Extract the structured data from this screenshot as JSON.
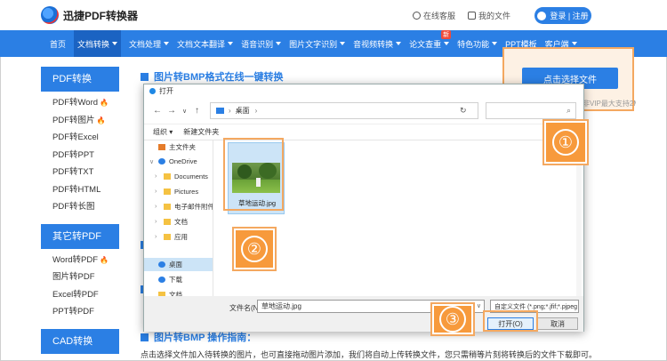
{
  "header": {
    "logo_text": "迅捷PDF转换器",
    "links": [
      "在线客服",
      "我的文件"
    ],
    "login": "登录 | 注册"
  },
  "nav": {
    "items": [
      {
        "label": "首页",
        "caret": false
      },
      {
        "label": "文档转换",
        "caret": true
      },
      {
        "label": "文档处理",
        "caret": true
      },
      {
        "label": "文档文本翻译",
        "caret": true
      },
      {
        "label": "语音识别",
        "caret": true
      },
      {
        "label": "图片文字识别",
        "caret": true
      },
      {
        "label": "音视频转换",
        "caret": true
      },
      {
        "label": "论文查重",
        "caret": true
      },
      {
        "label": "特色功能",
        "caret": true
      },
      {
        "label": "PPT模板",
        "caret": false
      },
      {
        "label": "客户端",
        "caret": true
      }
    ],
    "new_badge": "新"
  },
  "sidebar": {
    "groups": [
      {
        "title": "PDF转换",
        "items": [
          "PDF转Word",
          "PDF转图片",
          "PDF转Excel",
          "PDF转PPT",
          "PDF转TXT",
          "PDF转HTML",
          "PDF转长图"
        ],
        "hot": [
          0,
          1
        ]
      },
      {
        "title": "其它转PDF",
        "items": [
          "Word转PDF",
          "图片转PDF",
          "Excel转PDF",
          "PPT转PDF"
        ],
        "hot": [
          0
        ]
      },
      {
        "title": "CAD转换",
        "items": [],
        "hot": []
      }
    ]
  },
  "main": {
    "title": "图片转BMP格式在线一键转换",
    "guide_title": "图片转BMP 操作指南：",
    "guide_text": "点击选择文件加入待转换的图片，也可直接拖动图片添加，我们将自动上传转换文件，您只需稍等片刻将转换后的文件下载即可。"
  },
  "upload": {
    "button": "点击选择文件",
    "note": "请上传需要转换的图片，非VIP最大支持2M，支持JPG,PNG,BMP格式"
  },
  "dialog": {
    "title": "打开",
    "address": "桌面",
    "commands": [
      "组织",
      "新建文件夹"
    ],
    "tree": [
      {
        "label": "主文件夹",
        "icon": "home"
      },
      {
        "label": "OneDrive",
        "icon": "cloud"
      },
      {
        "label": "Documents",
        "icon": "folder"
      },
      {
        "label": "Pictures",
        "icon": "folder"
      },
      {
        "label": "电子邮件附件",
        "icon": "folder"
      },
      {
        "label": "文档",
        "icon": "folder"
      },
      {
        "label": "应用",
        "icon": "folder"
      },
      {
        "label": "桌面",
        "icon": "folder-blue"
      },
      {
        "label": "下载",
        "icon": "download"
      },
      {
        "label": "文档",
        "icon": "folder"
      }
    ],
    "file": {
      "name": "草地运动.jpg"
    },
    "filename_label": "文件名(N):",
    "filename_value": "草地运动.jpg",
    "filetype": "自定义文件 (*.png;*.jfif;*.pjpeg",
    "open_btn": "打开(O)",
    "cancel_btn": "取消"
  },
  "steps": [
    "①",
    "②",
    "③"
  ],
  "colors": {
    "brand": "#2b7fe4",
    "accent": "#f79a3c"
  }
}
